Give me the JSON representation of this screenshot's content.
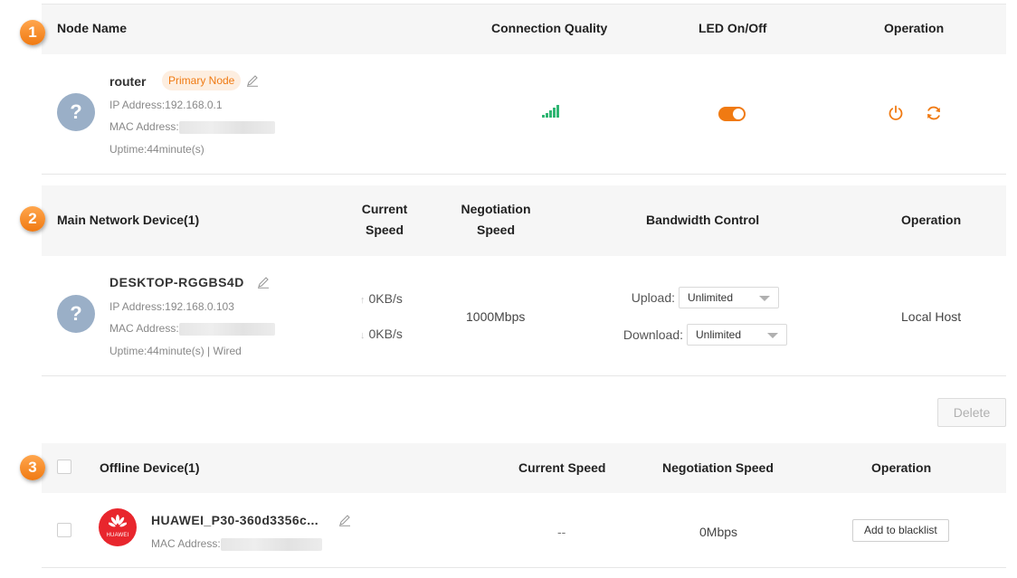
{
  "section1": {
    "badge": "1",
    "headers": {
      "node_name": "Node Name",
      "connection_quality": "Connection Quality",
      "led": "LED On/Off",
      "operation": "Operation"
    },
    "node": {
      "avatar": "?",
      "name": "router",
      "tag": "Primary Node",
      "ip": "IP Address:192.168.0.1",
      "mac_label": "MAC Address:",
      "uptime": "Uptime:44minute(s)",
      "signal_level": 5,
      "led_on": true,
      "icons": [
        "edit-icon",
        "signal-icon",
        "power-icon",
        "reboot-icon"
      ]
    }
  },
  "section2": {
    "badge": "2",
    "headers": {
      "device": "Main Network Device(1)",
      "current_speed_line1": "Current",
      "current_speed_line2": "Speed",
      "negotiation_line1": "Negotiation",
      "negotiation_line2": "Speed",
      "bandwidth": "Bandwidth Control",
      "operation": "Operation"
    },
    "device": {
      "avatar": "?",
      "name": "DESKTOP-RGGBS4D",
      "ip": "IP Address:192.168.0.103",
      "mac_label": "MAC Address:",
      "uptime": "Uptime:44minute(s) | Wired",
      "upload_speed": "0KB/s",
      "download_speed": "0KB/s",
      "negotiation": "1000Mbps",
      "upload_label": "Upload:",
      "upload_value": "Unlimited",
      "download_label": "Download:",
      "download_value": "Unlimited",
      "operation": "Local Host"
    }
  },
  "delete_label": "Delete",
  "section3": {
    "badge": "3",
    "headers": {
      "device": "Offline Device(1)",
      "current_speed": "Current Speed",
      "negotiation": "Negotiation Speed",
      "operation": "Operation"
    },
    "device": {
      "logo_text": "HUAWEI",
      "name": "HUAWEI_P30-360d3356c...",
      "mac_label": "MAC Address:",
      "current_speed": "--",
      "negotiation": "0Mbps",
      "action": "Add to blacklist"
    }
  },
  "colors": {
    "accent": "#f07a12",
    "signal": "#2fb673",
    "avatar": "#9aafc7",
    "huawei": "#e8262d"
  }
}
